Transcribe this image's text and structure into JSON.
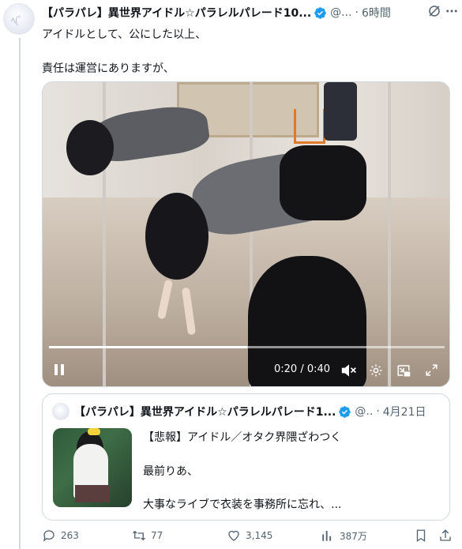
{
  "tweet": {
    "author_name": "【パラパレ】異世界アイドル☆パラレルパレード10...",
    "handle": "@...",
    "dot": "·",
    "time": "6時間",
    "lines": [
      "アイドルとして、公にした以上、",
      "責任は運営にありますが、"
    ]
  },
  "video": {
    "time_readout": "0:20 / 0:40",
    "progress": 0.5
  },
  "quote": {
    "author_name": "【パラパレ】異世界アイドル☆パラレルパレード1...",
    "handle": "@..",
    "dot": "·",
    "date": "4月21日",
    "lines": [
      "【悲報】アイドル／オタク界隈ざわつく",
      "最前りあ、",
      "大事なライブで衣装を事務所に忘れ、..."
    ]
  },
  "actions": {
    "replies": "263",
    "retweets": "77",
    "likes": "3,145",
    "views": "387万"
  },
  "colors": {
    "verified": "#1d9bf0",
    "secondary_text": "#536471",
    "border": "#cfd9de"
  }
}
